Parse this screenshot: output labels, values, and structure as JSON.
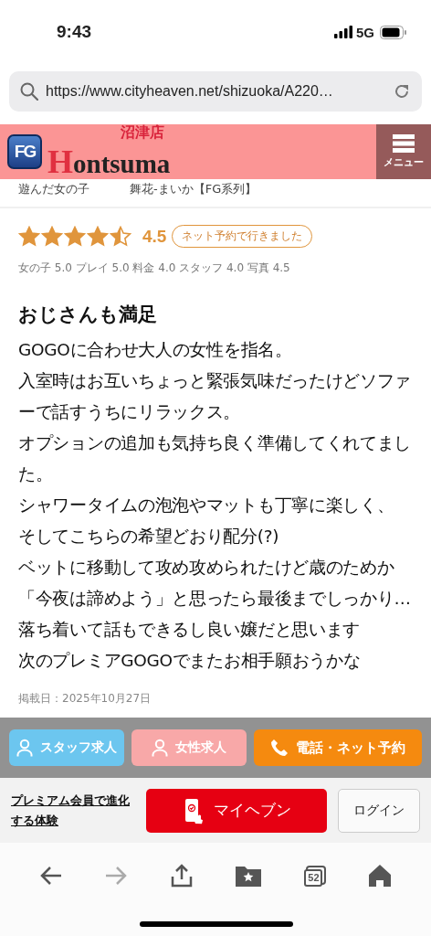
{
  "status_bar": {
    "time": "9:43",
    "network": "5G"
  },
  "address_bar": {
    "url": "https://www.cityheaven.net/shizuoka/A220…"
  },
  "header": {
    "logo_badge": "FG",
    "logo_text": "Hontsuma",
    "branch": "沼津店",
    "menu_label": "メニュー"
  },
  "girl": {
    "label": "遊んだ女の子",
    "name": "舞花-まいか【FG系列】"
  },
  "review": {
    "stars": 4.5,
    "score": "4.5",
    "badge": "ネット予約で行きました",
    "scores": "女の子 5.0 プレイ 5.0 料金 4.0 スタッフ 4.0 写真 4.5",
    "title": "おじさんも満足",
    "body": [
      "GOGOに合わせ大人の女性を指名。",
      "入室時はお互いちょっと緊張気味だったけどソファーで話すうちにリラックス。",
      "オプションの追加も気持ち良く準備してくれてました。",
      "シャワータイムの泡泡やマットも丁寧に楽しく、",
      "そしてこちらの希望どおり配分(?)",
      "ベットに移動して攻め攻められたけど歳のためか",
      "「今夜は諦めよう」と思ったら最後までしっかり…",
      "落ち着いて話もできるし良い嬢だと思います",
      "次のプレミアGOGOでまたお相手願おうかな"
    ],
    "posted": "掲載日：2025年10月27日"
  },
  "action_buttons": [
    {
      "kind": "staff",
      "label": "スタッフ求人"
    },
    {
      "kind": "female",
      "label": "女性求人"
    },
    {
      "kind": "reserve",
      "label": "電話・ネット予約"
    }
  ],
  "premium": {
    "link": "プレミアム会員で進化する体験",
    "mypage": "マイヘブン",
    "login": "ログイン"
  },
  "toolbar": {
    "tabs_count": "52",
    "forward_disabled": true
  }
}
